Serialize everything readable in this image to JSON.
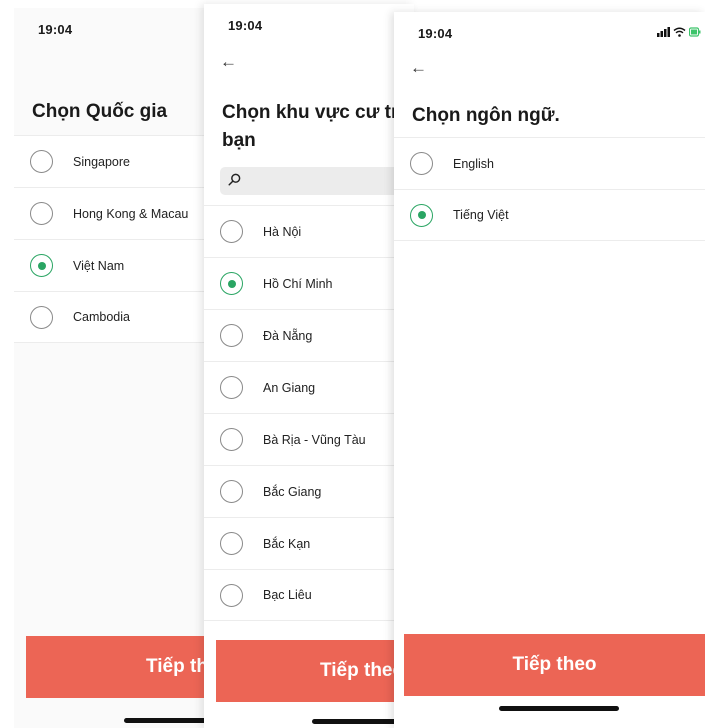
{
  "country_screen": {
    "time": "19:04",
    "title": "Chọn Quốc gia",
    "options": [
      {
        "label": "Singapore",
        "selected": false
      },
      {
        "label": "Hong Kong & Macau",
        "selected": false
      },
      {
        "label": "Việt Nam",
        "selected": true
      },
      {
        "label": "Cambodia",
        "selected": false
      }
    ],
    "button_label": "Tiếp theo"
  },
  "region_screen": {
    "time": "19:04",
    "title_line1": "Chọn khu vực cư trú của",
    "title_line2": "bạn",
    "options": [
      {
        "label": "Hà Nội",
        "selected": false
      },
      {
        "label": "Hồ Chí Minh",
        "selected": true
      },
      {
        "label": "Đà Nẵng",
        "selected": false
      },
      {
        "label": "An Giang",
        "selected": false
      },
      {
        "label": "Bà Rịa - Vũng Tàu",
        "selected": false
      },
      {
        "label": "Bắc Giang",
        "selected": false
      },
      {
        "label": "Bắc Kạn",
        "selected": false
      },
      {
        "label": "Bạc Liêu",
        "selected": false
      }
    ],
    "button_label": "Tiếp theo"
  },
  "language_screen": {
    "time": "19:04",
    "title": "Chọn ngôn ngữ.",
    "options": [
      {
        "label": "English",
        "selected": false
      },
      {
        "label": "Tiếng Việt",
        "selected": true
      }
    ],
    "button_label": "Tiếp theo"
  },
  "colors": {
    "accent_button": "#ec6555",
    "radio_selected": "#2aa563",
    "battery_charging": "#3cc46a"
  },
  "icons": [
    "back-arrow-icon",
    "search-icon",
    "signal-icon",
    "wifi-icon",
    "battery-icon"
  ]
}
